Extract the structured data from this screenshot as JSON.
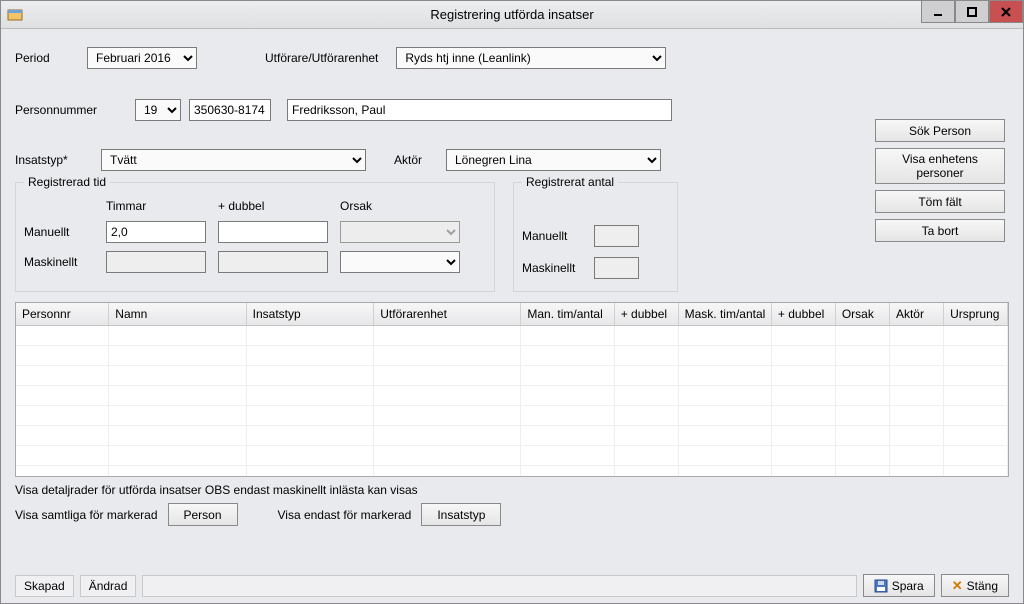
{
  "window": {
    "title": "Registrering utförda insatser"
  },
  "period": {
    "label": "Period",
    "value": "Februari 2016"
  },
  "performer": {
    "label": "Utförare/Utförarenhet",
    "value": "Ryds htj inne (Leanlink)"
  },
  "person": {
    "label": "Personnummer",
    "century": "19",
    "ssn": "350630-8174",
    "name": "Fredriksson, Paul"
  },
  "insatstyp": {
    "label": "Insatstyp*",
    "value": "Tvätt"
  },
  "aktor": {
    "label": "Aktör",
    "value": "Lönegren Lina"
  },
  "side_buttons": {
    "find_person": "Sök Person",
    "show_unit_persons": "Visa enhetens personer",
    "clear": "Töm fält",
    "remove": "Ta bort"
  },
  "reg_tid": {
    "legend": "Registrerad tid",
    "col_timmar": "Timmar",
    "col_dubbel": "+ dubbel",
    "col_orsak": "Orsak",
    "lbl_manuellt": "Manuellt",
    "man_timmar": "2,0",
    "lbl_maskinellt": "Maskinellt"
  },
  "reg_antal": {
    "legend": "Registrerat antal",
    "lbl_manuellt": "Manuellt",
    "lbl_maskinellt": "Maskinellt"
  },
  "table_headers": [
    "Personnr",
    "Namn",
    "Insatstyp",
    "Utförarenhet",
    "Man. tim/antal",
    "+ dubbel",
    "Mask. tim/antal",
    "+ dubbel",
    "Orsak",
    "Aktör",
    "Ursprung"
  ],
  "table_col_widths": [
    95,
    140,
    130,
    150,
    95,
    65,
    95,
    65,
    55,
    55,
    65
  ],
  "detail": {
    "heading": "Visa detaljrader för utförda insatser OBS endast maskinellt inlästa kan visas",
    "all_for_marked": "Visa samtliga för markerad",
    "person_btn": "Person",
    "only_for_marked": "Visa endast för markerad",
    "insatstyp_btn": "Insatstyp"
  },
  "status": {
    "created": "Skapad",
    "changed": "Ändrad",
    "save": "Spara",
    "close": "Stäng"
  }
}
